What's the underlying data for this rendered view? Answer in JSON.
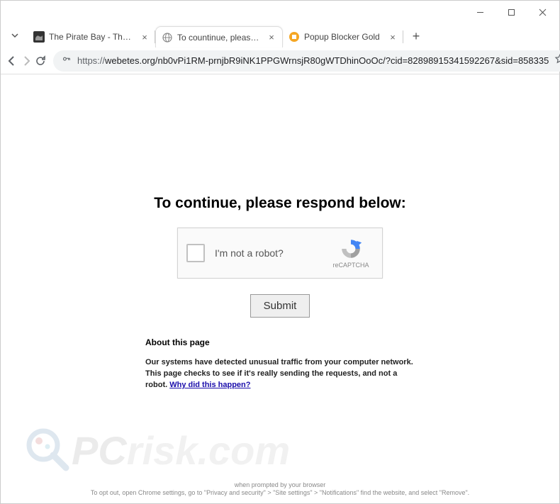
{
  "window": {
    "tabs": [
      {
        "title": "The Pirate Bay - The galaxy's m"
      },
      {
        "title": "To countinue, please respond b"
      },
      {
        "title": "Popup Blocker Gold"
      }
    ],
    "url_proto": "https://",
    "url_rest": "webetes.org/nb0vPi1RM-prnjbR9iNK1PPGWrnsjR80gWTDhinOoOc/?cid=82898915341592267&sid=858335"
  },
  "page": {
    "heading": "To continue, please respond below:",
    "captcha_label": "I'm not a robot?",
    "captcha_badge": "reCAPTCHA",
    "submit": "Submit",
    "about_title": "About this page",
    "about_text": "Our systems have detected unusual traffic from your computer network. This page checks to see if it's really sending the requests, and not a robot. ",
    "about_link": "Why did this happen?"
  },
  "watermark": {
    "text1": "PC",
    "text2": "risk.com"
  },
  "footer": {
    "line1": "when prompted by your browser",
    "line2": "To opt out, open Chrome settings, go to \"Privacy and security\" > \"Site settings\" > \"Notifications\" find the website, and select \"Remove\"."
  }
}
